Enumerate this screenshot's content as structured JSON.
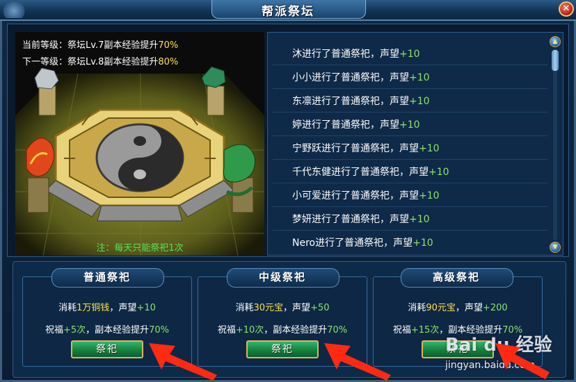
{
  "window": {
    "title": "帮派祭坛",
    "close_label": "✕"
  },
  "altar_panel": {
    "current_level_label": "当前等级：",
    "current_level_text": "祭坛Lv.7副本经验提升",
    "current_level_percent": "70%",
    "next_level_label": "下一等级：",
    "next_level_text": "祭坛Lv.8副本经验提升",
    "next_level_percent": "80%",
    "note": "注：每天只能祭祀1次"
  },
  "log": {
    "rows": [
      {
        "text": "沐进行了普通祭祀，声望",
        "reward": "+10"
      },
      {
        "text": "小小进行了普通祭祀，声望",
        "reward": "+10"
      },
      {
        "text": "东凛进行了普通祭祀，声望",
        "reward": "+10"
      },
      {
        "text": "婷进行了普通祭祀，声望",
        "reward": "+10"
      },
      {
        "text": "宁野跃进行了普通祭祀，声望",
        "reward": "+10"
      },
      {
        "text": "千代东健进行了普通祭祀，声望",
        "reward": "+10"
      },
      {
        "text": "小可爱进行了普通祭祀，声望",
        "reward": "+10"
      },
      {
        "text": "梦妍进行了普通祭祀，声望",
        "reward": "+10"
      },
      {
        "text": "Nero进行了普通祭祀，声望",
        "reward": "+10"
      }
    ],
    "scroll_up": "▲",
    "scroll_down": "▼"
  },
  "cards": [
    {
      "title": "普通祭祀",
      "cost_prefix": "消耗",
      "cost_amount": "1万铜钱",
      "cost_suffix": "，声望",
      "rep": "+10",
      "bless_prefix": "祝福",
      "bless": "+5次",
      "bless_suffix": "，副本经验提升",
      "exp": "70%",
      "button": "祭祀"
    },
    {
      "title": "中级祭祀",
      "cost_prefix": "消耗",
      "cost_amount": "30元宝",
      "cost_suffix": "，声望",
      "rep": "+50",
      "bless_prefix": "祝福",
      "bless": "+10次",
      "bless_suffix": "，副本经验提升",
      "exp": "70%",
      "button": "祭祀"
    },
    {
      "title": "高级祭祀",
      "cost_prefix": "消耗",
      "cost_amount": "90元宝",
      "cost_suffix": "，声望",
      "rep": "+200",
      "bless_prefix": "祝福",
      "bless": "+15次",
      "bless_suffix": "，副本经验提升",
      "exp": "70%",
      "button": "祭祀"
    }
  ],
  "watermark": {
    "brand": "Bai du 经验",
    "url": "jingyan.baidu.com"
  },
  "colors": {
    "highlight_yellow": "#ffe14a",
    "note_green": "#55e35a",
    "reward_green": "#8fe36b",
    "annotation_arrow": "#ff2a12"
  }
}
